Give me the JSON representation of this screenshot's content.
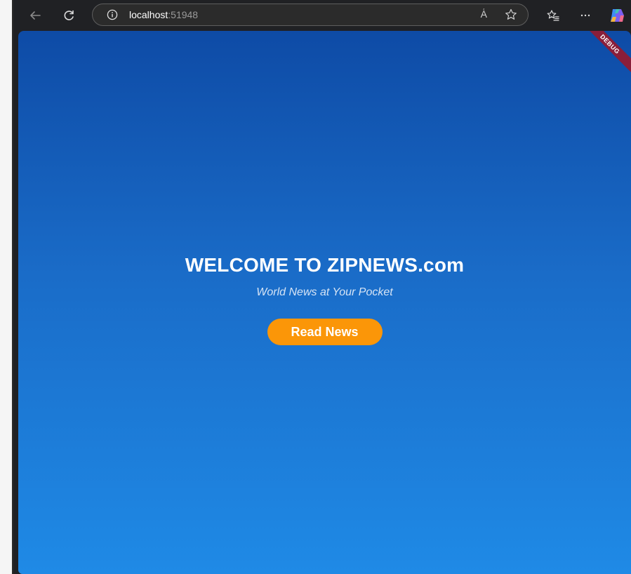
{
  "browser": {
    "url_host": "localhost",
    "url_port": ":51948",
    "read_aloud_glyph": "A͑",
    "icons": [
      "back-icon",
      "refresh-icon",
      "info-icon",
      "read-aloud-icon",
      "favorite-star-icon",
      "favorites-icon",
      "more-icon",
      "copilot-icon"
    ]
  },
  "app": {
    "debug_label": "DEBUG",
    "title": "WELCOME TO ZIPNEWS.com",
    "tagline": "World News at Your Pocket",
    "cta_label": "Read News",
    "colors": {
      "gradient_top": "#0e4ba6",
      "gradient_bottom": "#1f8ae6",
      "cta": "#fb9608",
      "debug_ribbon": "#8a1e3a"
    }
  }
}
